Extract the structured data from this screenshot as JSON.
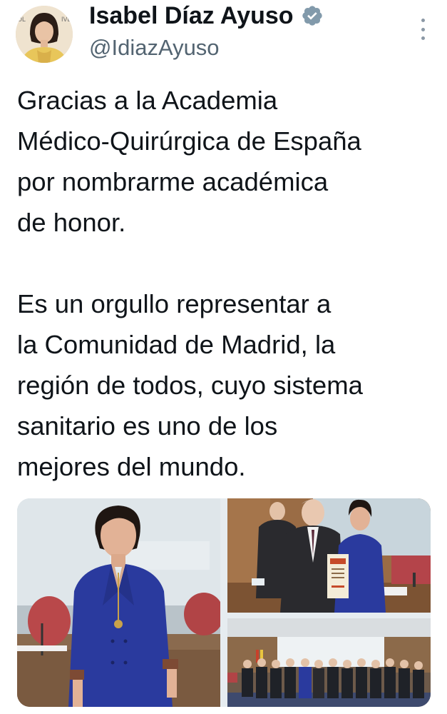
{
  "author": {
    "display_name": "Isabel Díaz Ayuso",
    "handle": "@IdiazAyuso",
    "verified": true,
    "avatar_icon": "profile-photo",
    "verified_color": "#829aab"
  },
  "tweet": {
    "paragraphs": [
      [
        "Gracias a la Academia",
        "Médico-Quirúrgica de España",
        "por nombrarme académica",
        "de honor."
      ],
      [
        "Es un orgullo representar a",
        "la Comunidad de Madrid, la",
        "región de todos, cuyo sistema",
        "sanitario es uno de los",
        "mejores del mundo."
      ]
    ]
  },
  "media": {
    "count": 3,
    "photos": [
      {
        "icon": "portrait-photo"
      },
      {
        "icon": "award-ceremony-photo"
      },
      {
        "icon": "group-photo"
      }
    ]
  },
  "menu": {
    "icon": "more-vertical-icon"
  },
  "colors": {
    "text": "#0f1419",
    "secondary_text": "#536471",
    "blazer_blue": "#2a3a9e"
  }
}
